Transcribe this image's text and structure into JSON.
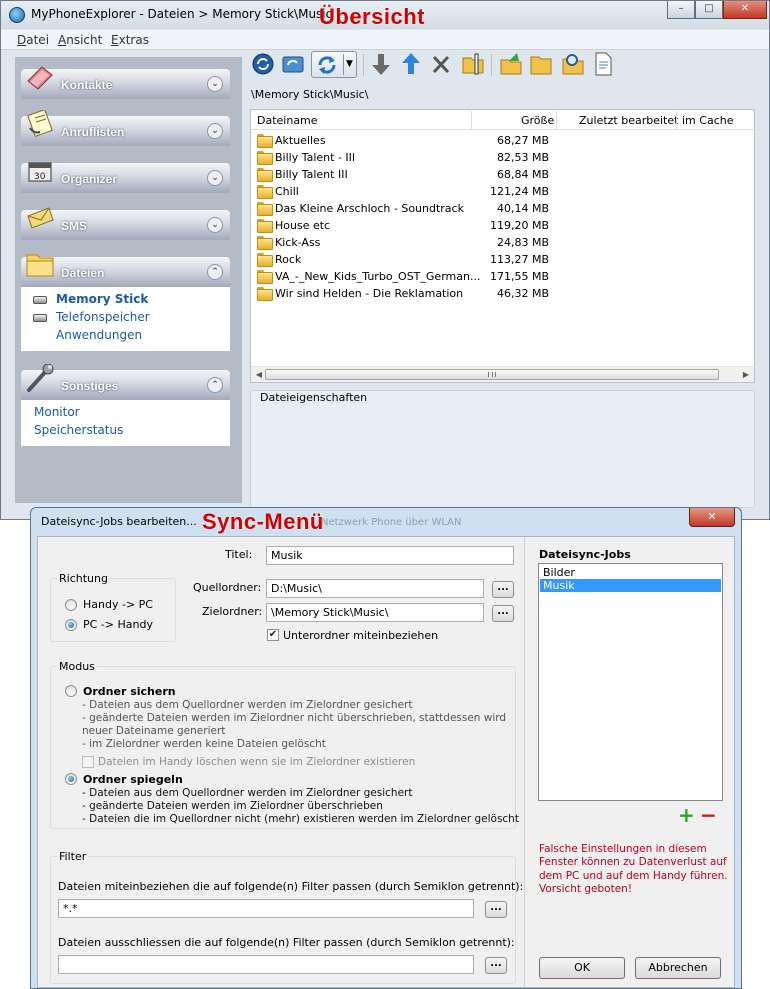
{
  "main_window": {
    "title": "MyPhoneExplorer -  Dateien > Memory Stick\\Music",
    "overlay_label": "Übersicht",
    "window_buttons": [
      "–",
      "□",
      "✕"
    ],
    "menu": [
      "Datei",
      "Ansicht",
      "Extras"
    ],
    "sidebar": {
      "panels": [
        {
          "label": "Kontakte",
          "icon": "contacts-book-icon",
          "expanded": false
        },
        {
          "label": "Anruflisten",
          "icon": "call-list-icon",
          "expanded": false
        },
        {
          "label": "Organizer",
          "icon": "organizer-calendar-icon",
          "expanded": false
        },
        {
          "label": "SMS",
          "icon": "sms-envelope-icon",
          "expanded": false
        },
        {
          "label": "Dateien",
          "icon": "files-folder-icon",
          "expanded": true,
          "items": [
            "Memory Stick",
            "Telefonspeicher",
            "Anwendungen"
          ]
        },
        {
          "label": "Sonstiges",
          "icon": "tools-wrench-icon",
          "expanded": true,
          "items": [
            "Monitor",
            "Speicherstatus"
          ]
        }
      ]
    },
    "path": "\\Memory Stick\\Music\\",
    "file_table": {
      "columns": [
        "Dateiname",
        "Größe",
        "Zuletzt bearbeitet",
        "im Cache"
      ],
      "rows": [
        {
          "name": "Aktuelles",
          "size": "68,27 MB"
        },
        {
          "name": "Billy Talent - III",
          "size": "82,53 MB"
        },
        {
          "name": "Billy Talent III",
          "size": "68,84 MB"
        },
        {
          "name": "Chill",
          "size": "121,24 MB"
        },
        {
          "name": "Das Kleine Arschloch - Soundtrack",
          "size": "40,14 MB"
        },
        {
          "name": "House etc",
          "size": "119,20 MB"
        },
        {
          "name": "Kick-Ass",
          "size": "24,83 MB"
        },
        {
          "name": "Rock",
          "size": "113,27 MB"
        },
        {
          "name": "VA_-_New_Kids_Turbo_OST_German...",
          "size": "171,55 MB"
        },
        {
          "name": "Wir sind Helden - Die Reklamation",
          "size": "46,32 MB"
        }
      ]
    },
    "properties_title": "Dateieigenschaften"
  },
  "dialog": {
    "title": "Dateisync-Jobs bearbeiten...",
    "overlay_label": "Sync-Menü",
    "ghost_text": "Netzwerk Phone über WLAN",
    "close_label": "✕",
    "titel_label": "Titel:",
    "titel_value": "Musik",
    "richtung": {
      "title": "Richtung",
      "options": [
        "Handy -> PC",
        "PC -> Handy"
      ],
      "selected": "PC -> Handy"
    },
    "quellordner_label": "Quellordner:",
    "quellordner_value": "D:\\Music\\",
    "zielordner_label": "Zielordner:",
    "zielordner_value": "\\Memory Stick\\Music\\",
    "browse_label": "...",
    "unterordner_label": "Unterordner miteinbeziehen",
    "unterordner_checked": true,
    "modus": {
      "title": "Modus",
      "sichern": {
        "label": "Ordner sichern",
        "lines": [
          "- Dateien aus dem Quellordner werden im Zielordner gesichert",
          "- geänderte Dateien werden im Zielordner nicht überschrieben, stattdessen wird",
          "neuer Dateiname generiert",
          "- im Zielordner werden keine Dateien gelöscht"
        ],
        "checkbox_label": "Dateien im Handy löschen wenn sie im Zielordner existieren"
      },
      "spiegeln": {
        "label": "Ordner spiegeln",
        "lines": [
          "- Dateien aus dem Quellordner werden im Zielordner gesichert",
          "- geänderte Dateien werden im Zielordner überschrieben",
          "- Dateien die im Quellordner nicht (mehr) existieren werden im Zielordner gelöscht"
        ]
      },
      "selected": "Ordner spiegeln"
    },
    "filter": {
      "title": "Filter",
      "include_label": "Dateien miteinbeziehen die auf folgende(n) Filter passen (durch Semiklon getrennt):",
      "include_value": "*.*",
      "exclude_label": "Dateien ausschliessen die auf folgende(n) Filter passen (durch Semiklon getrennt):",
      "exclude_value": ""
    },
    "jobs": {
      "title": "Dateisync-Jobs",
      "items": [
        "Bilder",
        "Musik"
      ],
      "selected": "Musik",
      "add_label": "+",
      "remove_label": "−"
    },
    "warning": "Falsche Einstellungen in diesem Fenster können zu Datenverlust auf dem PC und auf dem Handy führen. Vorsicht geboten!",
    "ok_label": "OK",
    "cancel_label": "Abbrechen"
  }
}
